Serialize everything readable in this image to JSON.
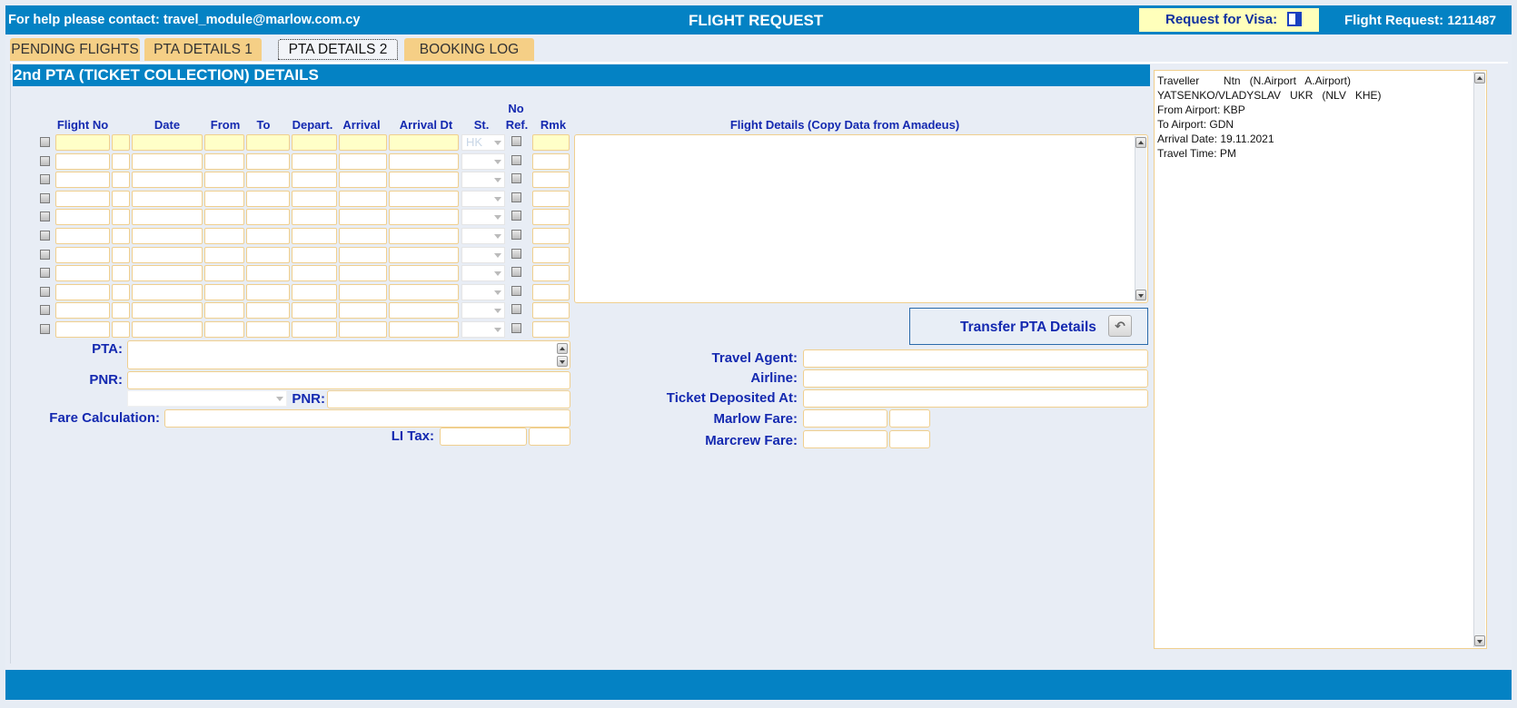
{
  "header": {
    "help_text": "For help please contact: travel_module@marlow.com.cy",
    "title": "FLIGHT REQUEST",
    "visa_label": "Request for Visa:",
    "request_label": "Flight Request:",
    "request_number": "1211487"
  },
  "tabs": [
    "PENDING FLIGHTS",
    "PTA DETAILS 1",
    "PTA DETAILS 2",
    "BOOKING LOG"
  ],
  "active_tab": "PTA DETAILS 2",
  "section_title": "2nd PTA (TICKET COLLECTION) DETAILS",
  "table": {
    "columns": [
      "Flight No",
      "Date",
      "From",
      "To",
      "Depart.",
      "Arrival",
      "Arrival Dt",
      "St.",
      "No",
      "Ref.",
      "Rmk"
    ],
    "first_row_status": "HK",
    "row_count": 11
  },
  "flight_details_label": "Flight Details (Copy Data from Amadeus)",
  "transfer_button": "Transfer PTA Details",
  "form": {
    "pta_label": "PTA:",
    "pnr_label": "PNR:",
    "pnr2_label": "PNR:",
    "fare_calc_label": "Fare Calculation:",
    "li_tax_label": "LI Tax:",
    "travel_agent_label": "Travel Agent:",
    "airline_label": "Airline:",
    "ticket_deposited_label": "Ticket Deposited At:",
    "marlow_fare_label": "Marlow Fare:",
    "marcrew_fare_label": "Marcrew Fare:"
  },
  "info_panel": {
    "lines": [
      "Traveller        Ntn   (N.Airport   A.Airport)",
      "YATSENKO/VLADYSLAV   UKR   (NLV   KHE)",
      "",
      "From Airport: KBP",
      "To Airport: GDN",
      "Arrival Date: 19.11.2021",
      "Travel Time: PM"
    ]
  }
}
